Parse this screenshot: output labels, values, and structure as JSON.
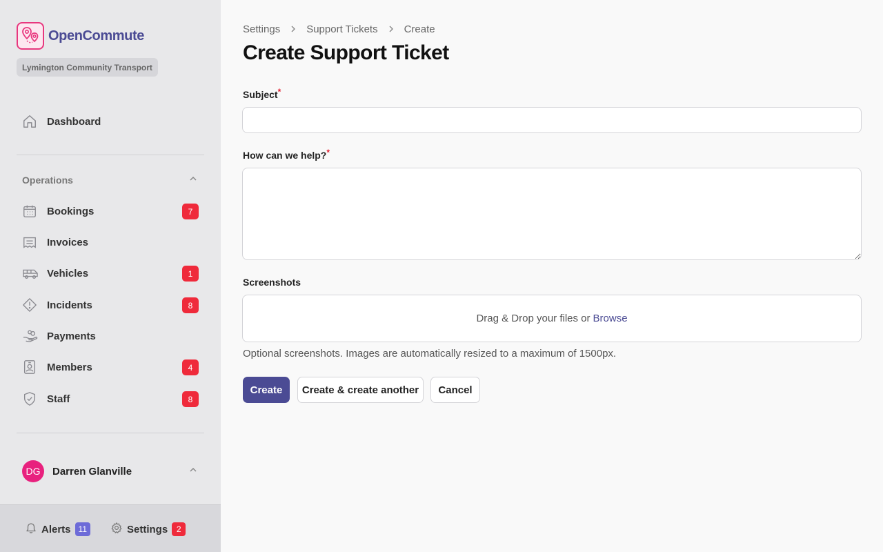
{
  "app": {
    "name": "OpenCommute",
    "organization": "Lymington Community Transport",
    "brand_color": "#4b4b94",
    "logo_color": "#e8377e"
  },
  "sidebar": {
    "dashboard": {
      "label": "Dashboard",
      "icon": "home-icon"
    },
    "group": {
      "label": "Operations",
      "expanded": true
    },
    "items": [
      {
        "label": "Bookings",
        "icon": "calendar-icon",
        "badge": "7"
      },
      {
        "label": "Invoices",
        "icon": "receipt-icon",
        "badge": ""
      },
      {
        "label": "Vehicles",
        "icon": "bus-icon",
        "badge": "1"
      },
      {
        "label": "Incidents",
        "icon": "warning-icon",
        "badge": "8"
      },
      {
        "label": "Payments",
        "icon": "payment-hand-icon",
        "badge": ""
      },
      {
        "label": "Members",
        "icon": "id-badge-icon",
        "badge": "4"
      },
      {
        "label": "Staff",
        "icon": "shield-icon",
        "badge": "8"
      }
    ],
    "user": {
      "initials": "DG",
      "name": "Darren Glanville"
    },
    "footer": {
      "alerts": {
        "label": "Alerts",
        "count": "11",
        "badge_color": "#6d6bd8"
      },
      "settings": {
        "label": "Settings",
        "count": "2",
        "badge_color": "#ef2a3b"
      }
    }
  },
  "breadcrumb": [
    "Settings",
    "Support Tickets",
    "Create"
  ],
  "page_title": "Create Support Ticket",
  "form": {
    "subject": {
      "label": "Subject",
      "required_mark": "*",
      "value": ""
    },
    "help": {
      "label": "How can we help?",
      "required_mark": "*",
      "value": ""
    },
    "screenshots": {
      "label": "Screenshots",
      "drop_text": "Drag & Drop your files or",
      "browse_label": "Browse",
      "help_text": "Optional screenshots. Images are automatically resized to a maximum of 1500px."
    },
    "buttons": {
      "create": "Create",
      "create_another": "Create & create another",
      "cancel": "Cancel"
    }
  }
}
